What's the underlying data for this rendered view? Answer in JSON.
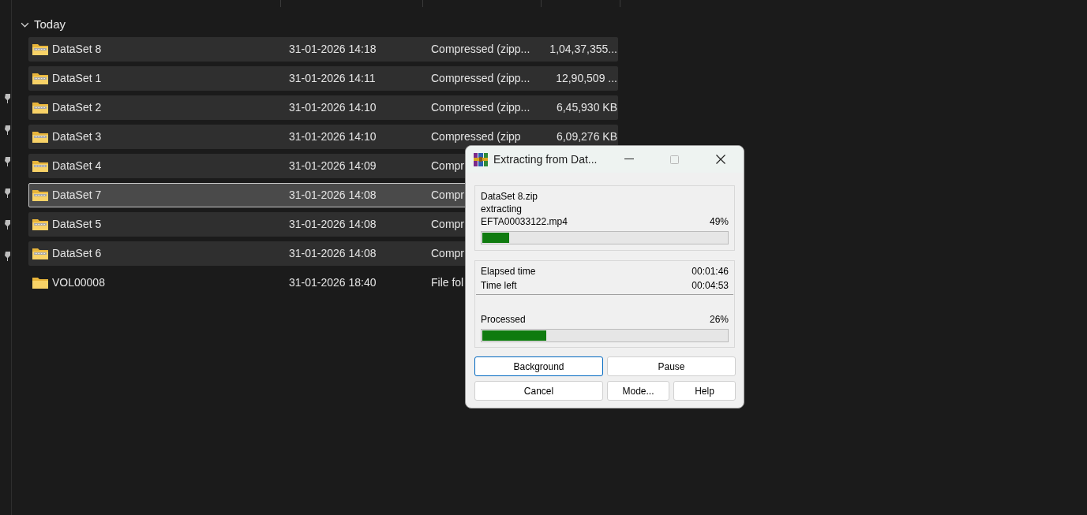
{
  "group": {
    "label": "Today",
    "expanded": true
  },
  "rows": [
    {
      "kind": "zip",
      "name": "DataSet 8",
      "date": "31-01-2026 14:18",
      "type": "Compressed (zipp...",
      "size": "1,04,37,355...",
      "selected": true,
      "focused": false
    },
    {
      "kind": "zip",
      "name": "DataSet 1",
      "date": "31-01-2026 14:11",
      "type": "Compressed (zipp...",
      "size": "12,90,509 ...",
      "selected": true,
      "focused": false
    },
    {
      "kind": "zip",
      "name": "DataSet 2",
      "date": "31-01-2026 14:10",
      "type": "Compressed (zipp...",
      "size": "6,45,930 KB",
      "selected": true,
      "focused": false
    },
    {
      "kind": "zip",
      "name": "DataSet 3",
      "date": "31-01-2026 14:10",
      "type": "Compressed (zipp",
      "size": "6,09,276 KB",
      "selected": true,
      "focused": false
    },
    {
      "kind": "zip",
      "name": "DataSet 4",
      "date": "31-01-2026 14:09",
      "type": "Compr",
      "selected": true,
      "focused": false
    },
    {
      "kind": "zip",
      "name": "DataSet 7",
      "date": "31-01-2026 14:08",
      "type": "Compr",
      "selected": true,
      "focused": true
    },
    {
      "kind": "zip",
      "name": "DataSet 5",
      "date": "31-01-2026 14:08",
      "type": "Compr",
      "selected": true,
      "focused": false
    },
    {
      "kind": "zip",
      "name": "DataSet 6",
      "date": "31-01-2026 14:08",
      "type": "Compr",
      "selected": true,
      "focused": false
    },
    {
      "kind": "folder",
      "name": "VOL00008",
      "date": "31-01-2026 18:40",
      "type": "File fol",
      "selected": false,
      "focused": false
    }
  ],
  "dialog": {
    "title": "Extracting from Dat...",
    "archive": "DataSet 8.zip",
    "action": "extracting",
    "file": "EFTA00033122.mp4",
    "file_percent": "49%",
    "file_progress": {
      "level": 0.11
    },
    "times": [
      {
        "label": "Elapsed time",
        "value": "00:01:46"
      },
      {
        "label": "Time left",
        "value": "00:04:53"
      }
    ],
    "processed_label": "Processed",
    "processed_percent": "26%",
    "processed_progress": {
      "level": 0.26
    },
    "buttons": [
      {
        "label": "Background",
        "focused": true
      },
      {
        "label": "Pause",
        "focused": false
      },
      {
        "label": "Cancel",
        "focused": false
      },
      {
        "label": "Mode...",
        "focused": false
      },
      {
        "label": "Help",
        "focused": false
      }
    ]
  }
}
